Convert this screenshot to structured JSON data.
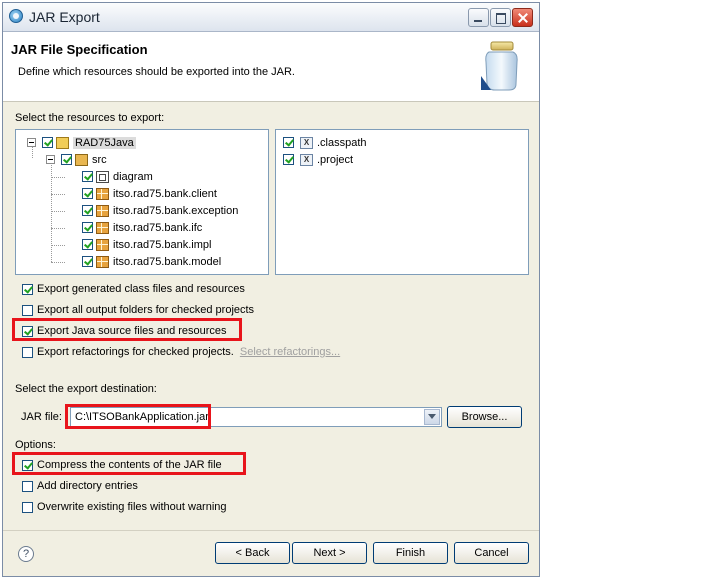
{
  "window": {
    "title": "JAR Export"
  },
  "header": {
    "title": "JAR File Specification",
    "description": "Define which resources should be exported into the JAR."
  },
  "resources": {
    "label": "Select the resources to export:",
    "tree": [
      {
        "label": "RAD75Java",
        "icon": "project-icon",
        "checked": true
      },
      {
        "label": "src",
        "icon": "source-folder-icon",
        "checked": true
      },
      {
        "label": "diagram",
        "icon": "diagram-icon",
        "checked": true
      },
      {
        "label": "itso.rad75.bank.client",
        "icon": "package-icon",
        "checked": true
      },
      {
        "label": "itso.rad75.bank.exception",
        "icon": "package-icon",
        "checked": true
      },
      {
        "label": "itso.rad75.bank.ifc",
        "icon": "package-icon",
        "checked": true
      },
      {
        "label": "itso.rad75.bank.impl",
        "icon": "package-icon",
        "checked": true
      },
      {
        "label": "itso.rad75.bank.model",
        "icon": "package-icon",
        "checked": true
      }
    ],
    "files": [
      {
        "label": ".classpath",
        "icon": "xml-file-icon",
        "checked": true
      },
      {
        "label": ".project",
        "icon": "xml-file-icon",
        "checked": true
      }
    ]
  },
  "export_options": {
    "class_files": {
      "label": "Export generated class files and resources",
      "checked": true
    },
    "output_folders": {
      "label": "Export all output folders for checked projects",
      "checked": false
    },
    "java_source": {
      "label": "Export Java source files and resources",
      "checked": true
    },
    "refactorings": {
      "label": "Export refactorings for checked projects.",
      "checked": false,
      "link": "Select refactorings..."
    }
  },
  "destination": {
    "label": "Select the export destination:",
    "jar_label": "JAR file:",
    "jar_value": "C:\\ITSOBankApplication.jar",
    "browse": "Browse..."
  },
  "options": {
    "label": "Options:",
    "compress": {
      "label": "Compress the contents of the JAR file",
      "checked": true
    },
    "directory": {
      "label": "Add directory entries",
      "checked": false
    },
    "overwrite": {
      "label": "Overwrite existing files without warning",
      "checked": false
    }
  },
  "buttons": {
    "help": "?",
    "back": "< Back",
    "next": "Next >",
    "finish": "Finish",
    "cancel": "Cancel"
  },
  "colors": {
    "highlight": "#e8141b",
    "check": "#21a121"
  }
}
